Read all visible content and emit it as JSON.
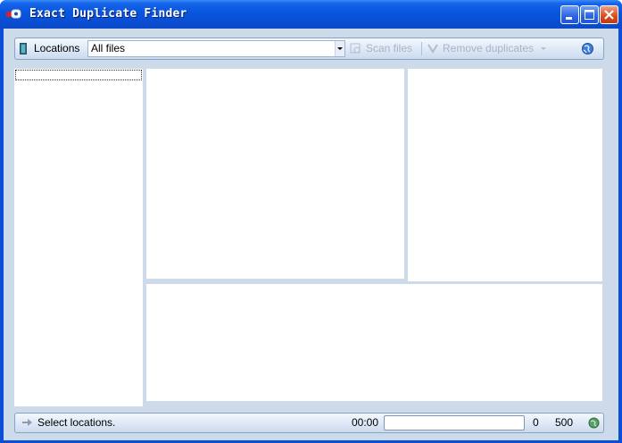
{
  "window": {
    "title": "Exact Duplicate Finder"
  },
  "toolbar": {
    "locations_label": "Locations",
    "filter_value": "All files",
    "scan_label": "Scan files",
    "remove_label": "Remove duplicates"
  },
  "status": {
    "message": "Select locations.",
    "elapsed": "00:00",
    "progress_percent": 0,
    "count": "0",
    "limit": "500"
  },
  "icons": [
    "app-icon",
    "minimize-icon",
    "maximize-icon",
    "close-icon",
    "locations-icon",
    "scan-icon",
    "remove-duplicates-icon",
    "web-icon",
    "arrow-right-icon",
    "status-globe-icon"
  ]
}
